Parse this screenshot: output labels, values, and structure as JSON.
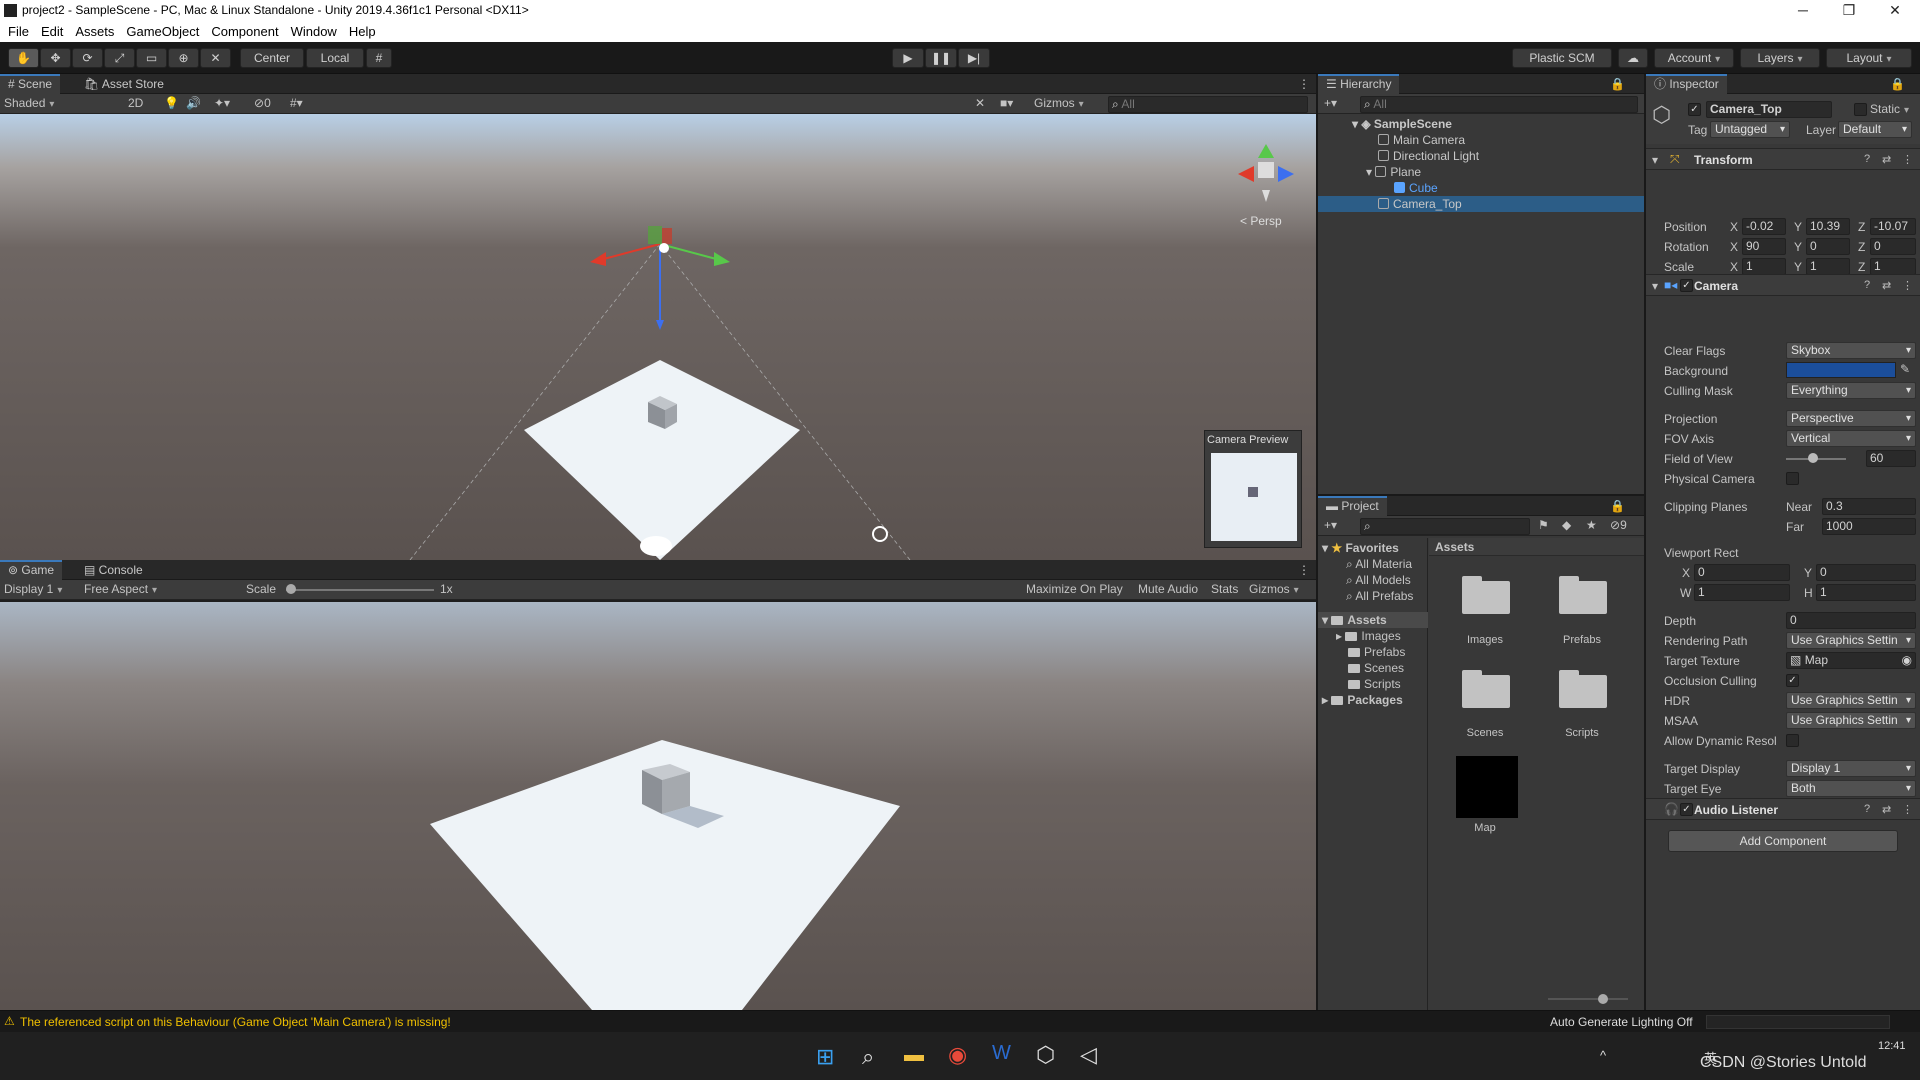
{
  "window": {
    "title": "project2 - SampleScene - PC, Mac & Linux Standalone - Unity 2019.4.36f1c1 Personal <DX11>",
    "controls": {
      "minimize": "─",
      "maximize": "❐",
      "close": "✕"
    }
  },
  "menu": [
    "File",
    "Edit",
    "Assets",
    "GameObject",
    "Component",
    "Window",
    "Help"
  ],
  "toolbar": {
    "pivot": "Center",
    "space": "Local",
    "plastic": "Plastic SCM",
    "account": "Account",
    "layers": "Layers",
    "layout": "Layout"
  },
  "scene": {
    "tabs": [
      "Scene",
      "Asset Store"
    ],
    "shading": "Shaded",
    "mode2d": "2D",
    "hidden_count": "0",
    "gizmos": "Gizmos",
    "search_placeholder": "All",
    "persp": "Persp",
    "camera_preview": "Camera Preview"
  },
  "game": {
    "tabs": [
      "Game",
      "Console"
    ],
    "display": "Display 1",
    "aspect": "Free Aspect",
    "scale_label": "Scale",
    "scale_value": "1x",
    "maximize": "Maximize On Play",
    "mute": "Mute Audio",
    "stats": "Stats",
    "gizmos": "Gizmos"
  },
  "hierarchy": {
    "title": "Hierarchy",
    "search_placeholder": "All",
    "scene": "SampleScene",
    "items": [
      "Main Camera",
      "Directional Light",
      "Plane",
      "Cube",
      "Camera_Top"
    ],
    "selected": "Camera_Top"
  },
  "project": {
    "title": "Project",
    "hidden_count": "9",
    "favorites": "Favorites",
    "fav_items": [
      "All Materia",
      "All Models",
      "All Prefabs"
    ],
    "assets_root": "Assets",
    "asset_folders": [
      "Images",
      "Prefabs",
      "Scenes",
      "Scripts"
    ],
    "packages": "Packages",
    "breadcrumb": "Assets",
    "grid": [
      "Images",
      "Prefabs",
      "Scenes",
      "Scripts",
      "Map"
    ]
  },
  "inspector": {
    "title": "Inspector",
    "object_name": "Camera_Top",
    "static": "Static",
    "tag_label": "Tag",
    "tag": "Untagged",
    "layer_label": "Layer",
    "layer": "Default",
    "transform": {
      "title": "Transform",
      "position_label": "Position",
      "rotation_label": "Rotation",
      "scale_label": "Scale",
      "position": {
        "x": "-0.02",
        "y": "10.39",
        "z": "-10.07"
      },
      "rotation": {
        "x": "90",
        "y": "0",
        "z": "0"
      },
      "scale": {
        "x": "1",
        "y": "1",
        "z": "1"
      }
    },
    "camera": {
      "title": "Camera",
      "clear_flags_label": "Clear Flags",
      "clear_flags": "Skybox",
      "background_label": "Background",
      "background_color": "#1b4e9b",
      "culling_mask_label": "Culling Mask",
      "culling_mask": "Everything",
      "projection_label": "Projection",
      "projection": "Perspective",
      "fov_axis_label": "FOV Axis",
      "fov_axis": "Vertical",
      "fov_label": "Field of View",
      "fov": "60",
      "physical_label": "Physical Camera",
      "clipping_label": "Clipping Planes",
      "near_label": "Near",
      "near": "0.3",
      "far_label": "Far",
      "far": "1000",
      "viewport_label": "Viewport Rect",
      "vx": "0",
      "vy": "0",
      "vw": "1",
      "vh": "1",
      "depth_label": "Depth",
      "depth": "0",
      "rendering_path_label": "Rendering Path",
      "rendering_path": "Use Graphics Settin",
      "target_texture_label": "Target Texture",
      "target_texture": "Map",
      "occlusion_label": "Occlusion Culling",
      "hdr_label": "HDR",
      "hdr": "Use Graphics Settin",
      "msaa_label": "MSAA",
      "msaa": "Use Graphics Settin",
      "dynres_label": "Allow Dynamic Resol",
      "target_display_label": "Target Display",
      "target_display": "Display 1",
      "target_eye_label": "Target Eye",
      "target_eye": "Both"
    },
    "audio_listener": "Audio Listener",
    "add_component": "Add Component"
  },
  "status": {
    "warning": "The referenced script on this Behaviour (Game Object 'Main Camera') is missing!",
    "lighting": "Auto Generate Lighting Off"
  },
  "taskbar": {
    "time": "12:41",
    "watermark": "CSDN @Stories Untold",
    "ime": "英"
  }
}
